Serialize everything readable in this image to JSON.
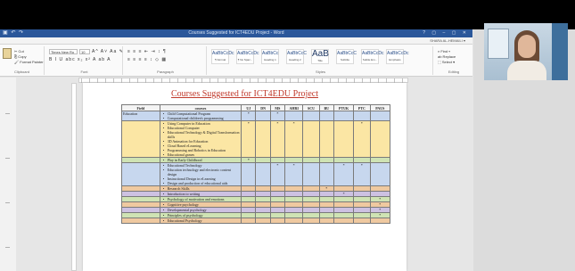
{
  "window": {
    "title": "Courses Suggested for ICT4EDU Project - Word",
    "quick_access": "▣ ↶ ↷",
    "controls": "?  ▢  –  ▢  ✕",
    "user": "Shara Al-Hemaili ▾"
  },
  "ribbon_tabs": [
    "FILE",
    "HOME",
    "INSERT",
    "DESIGN",
    "PAGE LAYOUT",
    "REFERENCES",
    "MAILINGS",
    "REVIEW",
    "VIEW"
  ],
  "ribbon": {
    "clipboard": {
      "cut": "✂ Cut",
      "copy": "⎘ Copy",
      "format_painter": "🖌 Format Painter",
      "label": "Clipboard"
    },
    "font": {
      "name": "Times New Ro",
      "size": "10",
      "label": "Font",
      "row1": "A^ A˅ Aa ✎",
      "row2": "B I U abc x₂ x² A ab A"
    },
    "paragraph": {
      "label": "Paragraph",
      "row1": "≡ ≡ ≡ ⇤ ⇥ ↕ ¶",
      "row2": "≡ ≡ ≡ ≡ ↕ ◇ ▦"
    },
    "styles": {
      "label": "Styles",
      "items": [
        {
          "sample": "AaBbCcDc",
          "name": "¶ Normal",
          "big": false
        },
        {
          "sample": "AaBbCcDc",
          "name": "¶ No Spac...",
          "big": false
        },
        {
          "sample": "AaBbCc",
          "name": "Heading 1",
          "big": false
        },
        {
          "sample": "AaBbCcC",
          "name": "Heading 2",
          "big": false
        },
        {
          "sample": "AaB",
          "name": "Title",
          "big": true
        },
        {
          "sample": "AaBbCcC",
          "name": "Subtitle",
          "big": false
        },
        {
          "sample": "AaBbCcDc",
          "name": "Subtle Em...",
          "big": false
        },
        {
          "sample": "AaBbCcDc",
          "name": "Emphasis",
          "big": false
        }
      ]
    },
    "editing": {
      "find": "⌕ Find ▾",
      "replace": "ab Replace",
      "select": "⬚ Select ▾",
      "label": "Editing"
    }
  },
  "document": {
    "heading": "Courses Suggested for ICT4EDU Project",
    "table": {
      "columns": [
        "Field",
        "courses",
        "UJ",
        "DN",
        "MS",
        "AHRI",
        "SCU",
        "BU",
        "PTUK",
        "PTC",
        "PAUS"
      ],
      "rows": [
        {
          "band": "b-blue",
          "field": "Education",
          "courses": [
            "Child Computational Program",
            "Computational children's programming"
          ],
          "marks": [
            "*",
            "",
            "*",
            "",
            "",
            "",
            "",
            "",
            ""
          ]
        },
        {
          "band": "b-yellow",
          "field": "",
          "courses": [
            "Using Computer in Education",
            "Educational Computer",
            "Educational Technology & Digital Transformation skills",
            "3D Animation for Education",
            "Cloud Based eLearning",
            "Programming and Robotics in Education",
            "Educational games"
          ],
          "marks": [
            "*",
            "",
            "*",
            "*",
            "",
            "",
            "",
            "*",
            ""
          ]
        },
        {
          "band": "b-green",
          "field": "",
          "courses": [
            "Play in Early Childhood"
          ],
          "marks": [
            "*",
            "",
            "",
            "",
            "",
            "",
            "",
            "",
            ""
          ]
        },
        {
          "band": "b-blue",
          "field": "",
          "courses": [
            "Educational Technology",
            "Education technology and electronic content design",
            "Instructional Design in eLearning",
            "Design and production of educational aids"
          ],
          "marks": [
            "",
            "",
            "*",
            "*",
            "",
            "",
            "*",
            "*",
            ""
          ]
        },
        {
          "band": "b-tan",
          "field": "",
          "courses": [
            "Research Skills"
          ],
          "marks": [
            "",
            "",
            "",
            "",
            "",
            "*",
            "",
            "",
            ""
          ]
        },
        {
          "band": "b-purple",
          "field": "",
          "courses": [
            "Introduction to writing"
          ],
          "marks": [
            "",
            "",
            "",
            "",
            "",
            "",
            "*",
            "",
            ""
          ]
        },
        {
          "band": "b-green",
          "field": "",
          "courses": [
            "Psychology of motivation and emotions"
          ],
          "marks": [
            "",
            "",
            "",
            "",
            "",
            "",
            "",
            "",
            "*"
          ]
        },
        {
          "band": "b-tan",
          "field": "",
          "courses": [
            "Cognitive psychology"
          ],
          "marks": [
            "",
            "",
            "",
            "",
            "",
            "",
            "",
            "",
            "*"
          ]
        },
        {
          "band": "b-purple",
          "field": "",
          "courses": [
            "Developmental psychology"
          ],
          "marks": [
            "",
            "",
            "",
            "",
            "",
            "",
            "",
            "",
            "*"
          ]
        },
        {
          "band": "b-green",
          "field": "",
          "courses": [
            "Principles of psychology"
          ],
          "marks": [
            "",
            "",
            "",
            "",
            "",
            "",
            "",
            "",
            "*"
          ]
        },
        {
          "band": "b-tan",
          "field": "",
          "courses": [
            "Educational Psychology"
          ],
          "marks": [
            "",
            "",
            "",
            "",
            "",
            "",
            "",
            "",
            ""
          ]
        }
      ]
    }
  },
  "colors": {
    "word_blue": "#2b579a",
    "heading_red": "#c0392b"
  },
  "icons": [
    "paste-icon",
    "webcam-feed"
  ]
}
